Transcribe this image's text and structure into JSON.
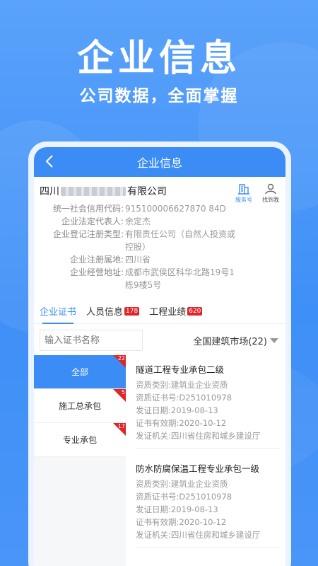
{
  "promo": {
    "title": "企业信息",
    "subtitle": "公司数据，全面掌握"
  },
  "nav": {
    "title": "企业信息"
  },
  "company": {
    "name_prefix": "四川",
    "name_suffix": "有限公司",
    "actions": [
      {
        "label": "服务号",
        "icon": "building-icon"
      },
      {
        "label": "找到我",
        "icon": "person-icon"
      }
    ],
    "fields": [
      {
        "label": "统一社会信用代码:",
        "value": "915100006627870 84D"
      },
      {
        "label": "企业法定代表人:",
        "value": "余定杰"
      },
      {
        "label": "企业登记注册类型:",
        "value": "有限责任公司（自然人投资或控股）"
      },
      {
        "label": "企业注册属地:",
        "value": "四川省"
      },
      {
        "label": "企业经营地址:",
        "value": "成都市武侯区科华北路19号1栋9楼5号"
      }
    ]
  },
  "tabs": [
    {
      "label": "企业证书",
      "badge": ""
    },
    {
      "label": "人员信息",
      "badge": "178"
    },
    {
      "label": "工程业绩",
      "badge": "620"
    }
  ],
  "filter": {
    "search_placeholder": "输入证书名称",
    "market": "全国建筑市场(22)"
  },
  "categories": [
    {
      "label": "全部",
      "count": "22"
    },
    {
      "label": "施工总承包",
      "count": "5"
    },
    {
      "label": "专业承包",
      "count": "17"
    }
  ],
  "certificates": [
    {
      "title": "隧道工程专业承包二级",
      "type_label": "资质类别:",
      "type": "建筑业企业资质",
      "no_label": "资质证书号:",
      "no": "D251010978",
      "issue_label": "发证日期:",
      "issue": "2019-08-13",
      "valid_label": "证书有效期:",
      "valid": "2020-10-12",
      "org_label": "发证机关:",
      "org": "四川省住房和城乡建设厅"
    },
    {
      "title": "防水防腐保温工程专业承包一级",
      "type_label": "资质类别:",
      "type": "建筑业企业资质",
      "no_label": "资质证书号:",
      "no": "D251010978",
      "issue_label": "发证日期:",
      "issue": "2019-08-13",
      "valid_label": "证书有效期:",
      "valid": "2020-10-12",
      "org_label": "发证机关:",
      "org": "四川省住房和城乡建设厅"
    }
  ],
  "colors": {
    "brand": "#3b8df5",
    "badge": "#e0262a"
  }
}
